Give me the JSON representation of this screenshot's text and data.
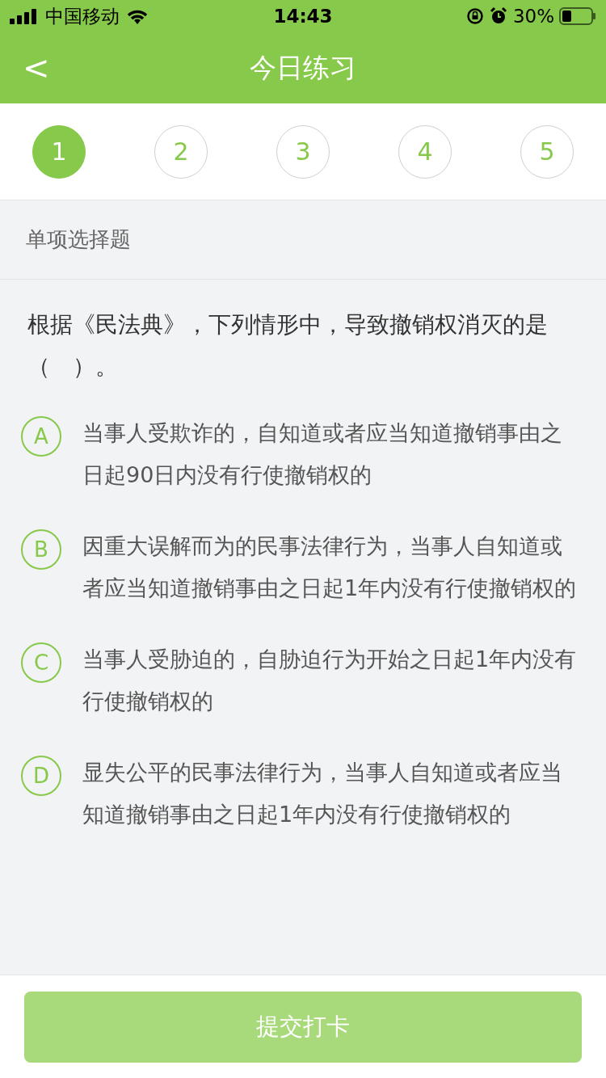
{
  "status_bar": {
    "carrier": "中国移动",
    "time": "14:43",
    "battery": "30%"
  },
  "nav": {
    "back": "<",
    "title": "今日练习"
  },
  "steps": [
    {
      "label": "1",
      "selected": true
    },
    {
      "label": "2",
      "selected": false
    },
    {
      "label": "3",
      "selected": false
    },
    {
      "label": "4",
      "selected": false
    },
    {
      "label": "5",
      "selected": false
    }
  ],
  "question_type": "单项选择题",
  "question": "根据《民法典》，下列情形中，导致撤销权消灭的是（　）。",
  "options": [
    {
      "letter": "A",
      "text": "当事人受欺诈的，自知道或者应当知道撤销事由之日起90日内没有行使撤销权的",
      "selected": false
    },
    {
      "letter": "B",
      "text": "因重大误解而为的民事法律行为，当事人自知道或者应当知道撤销事由之日起1年内没有行使撤销权的",
      "selected": false
    },
    {
      "letter": "C",
      "text": "当事人受胁迫的，自胁迫行为开始之日起1年内没有行使撤销权的",
      "selected": false
    },
    {
      "letter": "D",
      "text": "显失公平的民事法律行为，当事人自知道或者应当知道撤销事由之日起1年内没有行使撤销权的",
      "selected": false
    }
  ],
  "submit": {
    "label": "提交打卡",
    "disabled": true
  }
}
